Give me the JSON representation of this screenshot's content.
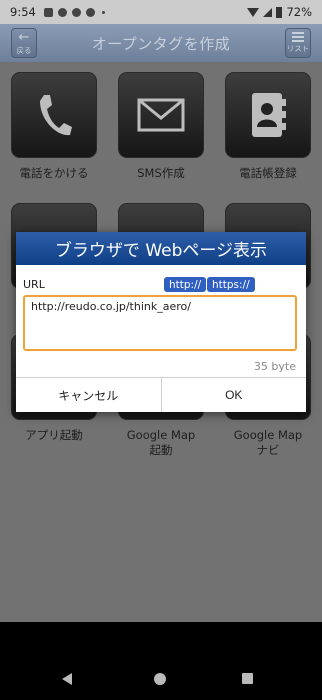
{
  "status_bar": {
    "time": "9:54",
    "battery": "72%"
  },
  "header": {
    "title": "オープンタグを作成",
    "back_label": "戻る",
    "list_label": "リスト"
  },
  "tiles": [
    {
      "label": "電話をかける",
      "icon": "phone-icon"
    },
    {
      "label": "SMS作成",
      "icon": "mail-icon"
    },
    {
      "label": "電話帳登録",
      "icon": "contacts-icon"
    },
    {
      "label": "",
      "icon": "tile-icon"
    },
    {
      "label": "",
      "icon": "globe-icon"
    },
    {
      "label": "",
      "icon": "facebook-icon"
    },
    {
      "label": "アプリ起動",
      "icon": "app-icon"
    },
    {
      "label": "Google Map\n起動",
      "icon": "map-icon"
    },
    {
      "label": "Google Map\nナビ",
      "icon": "navi-icon"
    }
  ],
  "dialog": {
    "title": "ブラウザで Webページ表示",
    "url_label": "URL",
    "http_button": "http://",
    "https_button": "https://",
    "url_value": "http://reudo.co.jp/think_aero/",
    "byte_count": "35 byte",
    "cancel_label": "キャンセル",
    "ok_label": "OK"
  }
}
